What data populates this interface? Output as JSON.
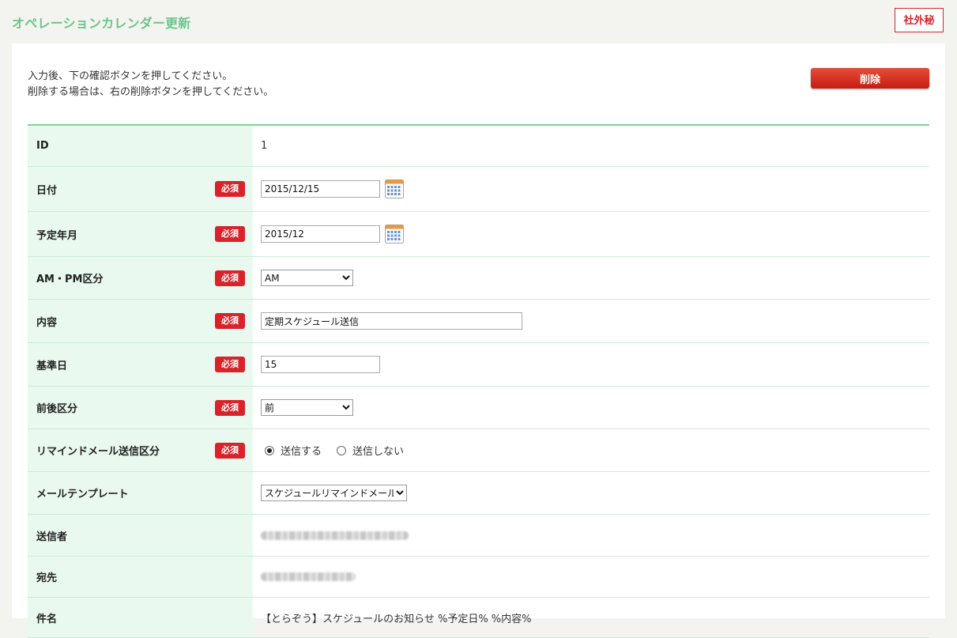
{
  "header": {
    "title": "オペレーションカレンダー更新",
    "confidential_badge": "社外秘"
  },
  "instructions": {
    "line1": "入力後、下の確認ボタンを押してください。",
    "line2": "削除する場合は、右の削除ボタンを押してください。"
  },
  "delete_button_label": "削除",
  "required_label": "必須",
  "fields": {
    "id": {
      "label": "ID",
      "value": "1"
    },
    "date": {
      "label": "日付",
      "value": "2015/12/15"
    },
    "planned_month": {
      "label": "予定年月",
      "value": "2015/12"
    },
    "ampm": {
      "label": "AM・PM区分",
      "selected": "AM"
    },
    "content": {
      "label": "内容",
      "value": "定期スケジュール送信"
    },
    "base_day": {
      "label": "基準日",
      "value": "15"
    },
    "before_after": {
      "label": "前後区分",
      "selected": "前"
    },
    "remind": {
      "label": "リマインドメール送信区分",
      "option_send": "送信する",
      "option_no_send": "送信しない"
    },
    "template": {
      "label": "メールテンプレート",
      "selected": "スケジュールリマインドメール"
    },
    "sender": {
      "label": "送信者"
    },
    "recipient": {
      "label": "宛先"
    },
    "subject": {
      "label": "件名",
      "value": "【とらぞう】スケジュールのお知らせ %予定日% %内容%"
    }
  },
  "colors": {
    "title_green": "#6cc58d",
    "required_red": "#d8232a",
    "label_bg": "#e9f9ef",
    "border_green": "#7fcf97"
  }
}
